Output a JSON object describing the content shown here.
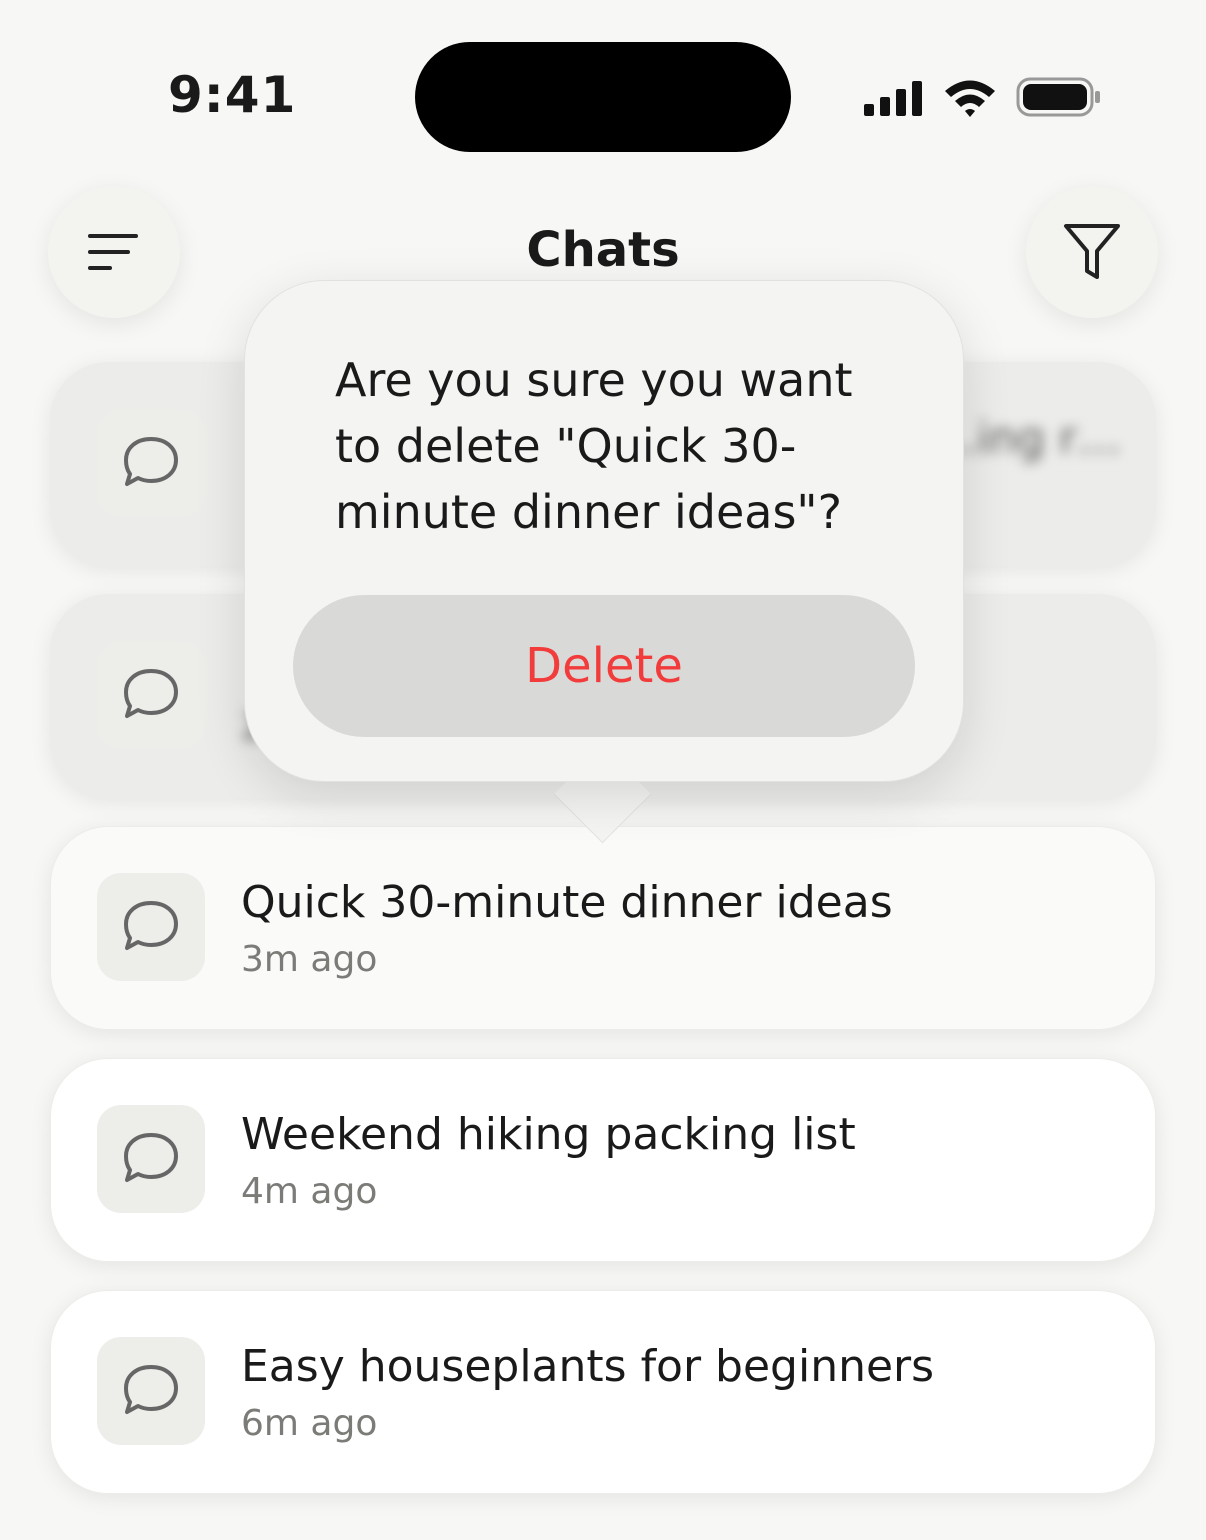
{
  "status_bar": {
    "time": "9:41",
    "icons": [
      "cellular-signal-icon",
      "wifi-icon",
      "battery-icon"
    ]
  },
  "header": {
    "title": "Chats",
    "left_button_icon": "menu-icon",
    "right_button_icon": "filter-icon"
  },
  "chats": [
    {
      "title": "…ing r…",
      "time": "",
      "icon": "chat-bubble-icon",
      "obscured": true
    },
    {
      "title": "",
      "time": "2…",
      "icon": "chat-bubble-icon",
      "obscured": true
    },
    {
      "title": "Quick 30-minute dinner ideas",
      "time": "3m ago",
      "icon": "chat-bubble-icon"
    },
    {
      "title": "Weekend hiking packing list",
      "time": "4m ago",
      "icon": "chat-bubble-icon"
    },
    {
      "title": "Easy houseplants for beginners",
      "time": "6m ago",
      "icon": "chat-bubble-icon"
    }
  ],
  "dialog": {
    "message": "Are you sure you want to delete \"Quick 30-minute dinner ideas\"?",
    "delete_label": "Delete"
  },
  "colors": {
    "background": "#f7f7f5",
    "destructive": "#f23c3c",
    "card": "#ffffff",
    "icon_box": "#ededea",
    "secondary_text": "#7b7b78"
  }
}
